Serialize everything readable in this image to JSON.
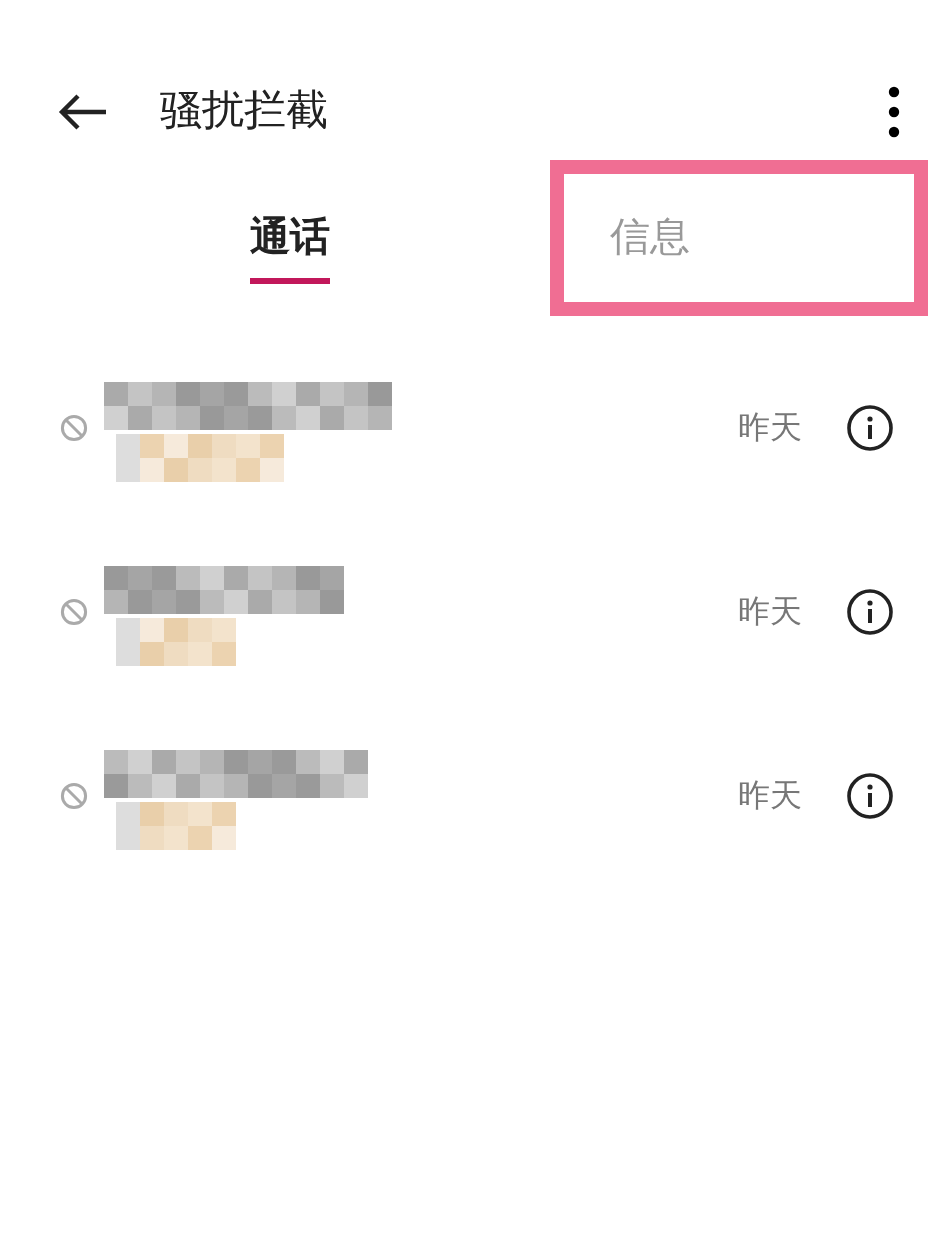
{
  "header": {
    "title": "骚扰拦截"
  },
  "tabs": [
    {
      "label": "通话",
      "selected": true,
      "annotated": false
    },
    {
      "label": "信息",
      "selected": false,
      "annotated": true
    }
  ],
  "rows": [
    {
      "time": "昨天"
    },
    {
      "time": "昨天"
    },
    {
      "time": "昨天"
    }
  ]
}
